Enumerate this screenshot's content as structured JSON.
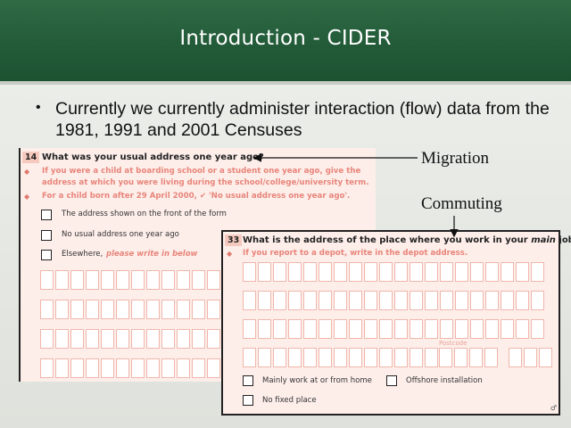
{
  "slide": {
    "title": "Introduction - CIDER",
    "bullet": "Currently we currently administer interaction (flow) data from the 1981, 1991 and 2001 Censuses"
  },
  "annotations": {
    "migration": "Migration",
    "commuting": "Commuting"
  },
  "q14": {
    "number": "14",
    "question": "What was your usual address one year ago?",
    "note1": "If you were a child at boarding school or a student one year ago, give the address at which you were living during the school/college/university term.",
    "note2": "For a child born after 29 April 2000, ✔ 'No usual address one year ago'.",
    "options": [
      "The address shown on the front of the form",
      "No usual address one year ago",
      "Elsewhere,"
    ],
    "elsewhere_hint": "please write in below"
  },
  "q33": {
    "number": "33",
    "question_prefix": "What is the address of the place where you work in your ",
    "question_em": "main",
    "question_suffix": " job?",
    "note": "If you report to a depot, write in the depot address.",
    "postcode_label": "Postcode",
    "options": [
      "Mainly work at or from home",
      "Offshore installation",
      "No fixed place"
    ]
  },
  "colors": {
    "banner": "#225a37",
    "form_background": "#fdeeea",
    "form_note_text": "#e8857a"
  }
}
